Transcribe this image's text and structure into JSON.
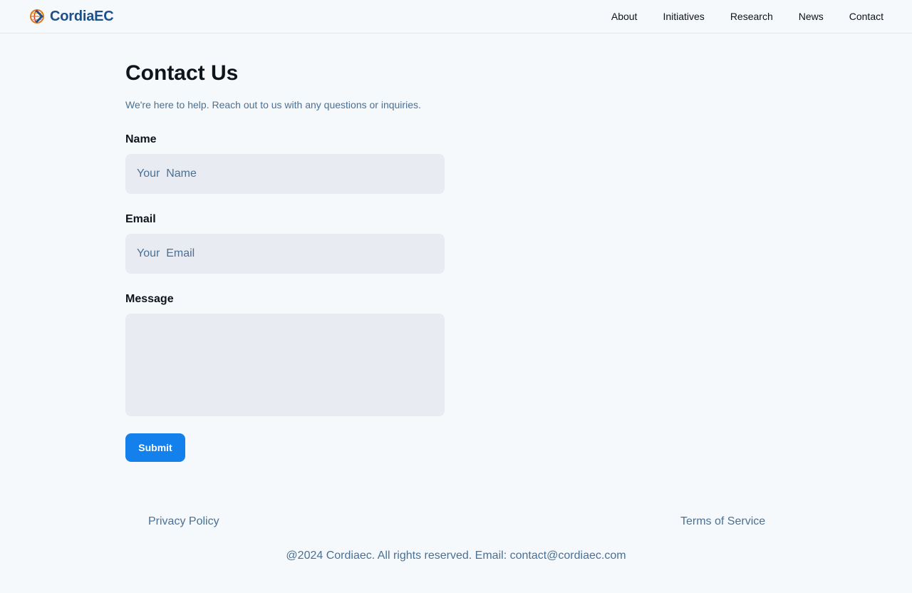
{
  "header": {
    "brand": "CordiaEC",
    "logo_icon": "globe-logo-icon",
    "nav": [
      {
        "label": "About"
      },
      {
        "label": "Initiatives"
      },
      {
        "label": "Research"
      },
      {
        "label": "News"
      },
      {
        "label": "Contact"
      }
    ]
  },
  "main": {
    "title": "Contact Us",
    "subtitle": "We're here to help. Reach out to us with any questions or inquiries.",
    "form": {
      "name_label": "Name",
      "name_placeholder": "Your  Name",
      "email_label": "Email",
      "email_placeholder": "Your  Email",
      "message_label": "Message",
      "message_value": "",
      "submit_label": "Submit"
    }
  },
  "footer": {
    "privacy": "Privacy Policy",
    "terms": "Terms of Service",
    "copyright": "@2024 Cordiaec. All rights reserved. Email: contact@cordiaec.com"
  },
  "colors": {
    "background": "#f6f9fc",
    "brand_text": "#1d4f8a",
    "accent": "#1380ec",
    "input_bg": "#e8ebf2",
    "muted_text": "#4a7094"
  }
}
